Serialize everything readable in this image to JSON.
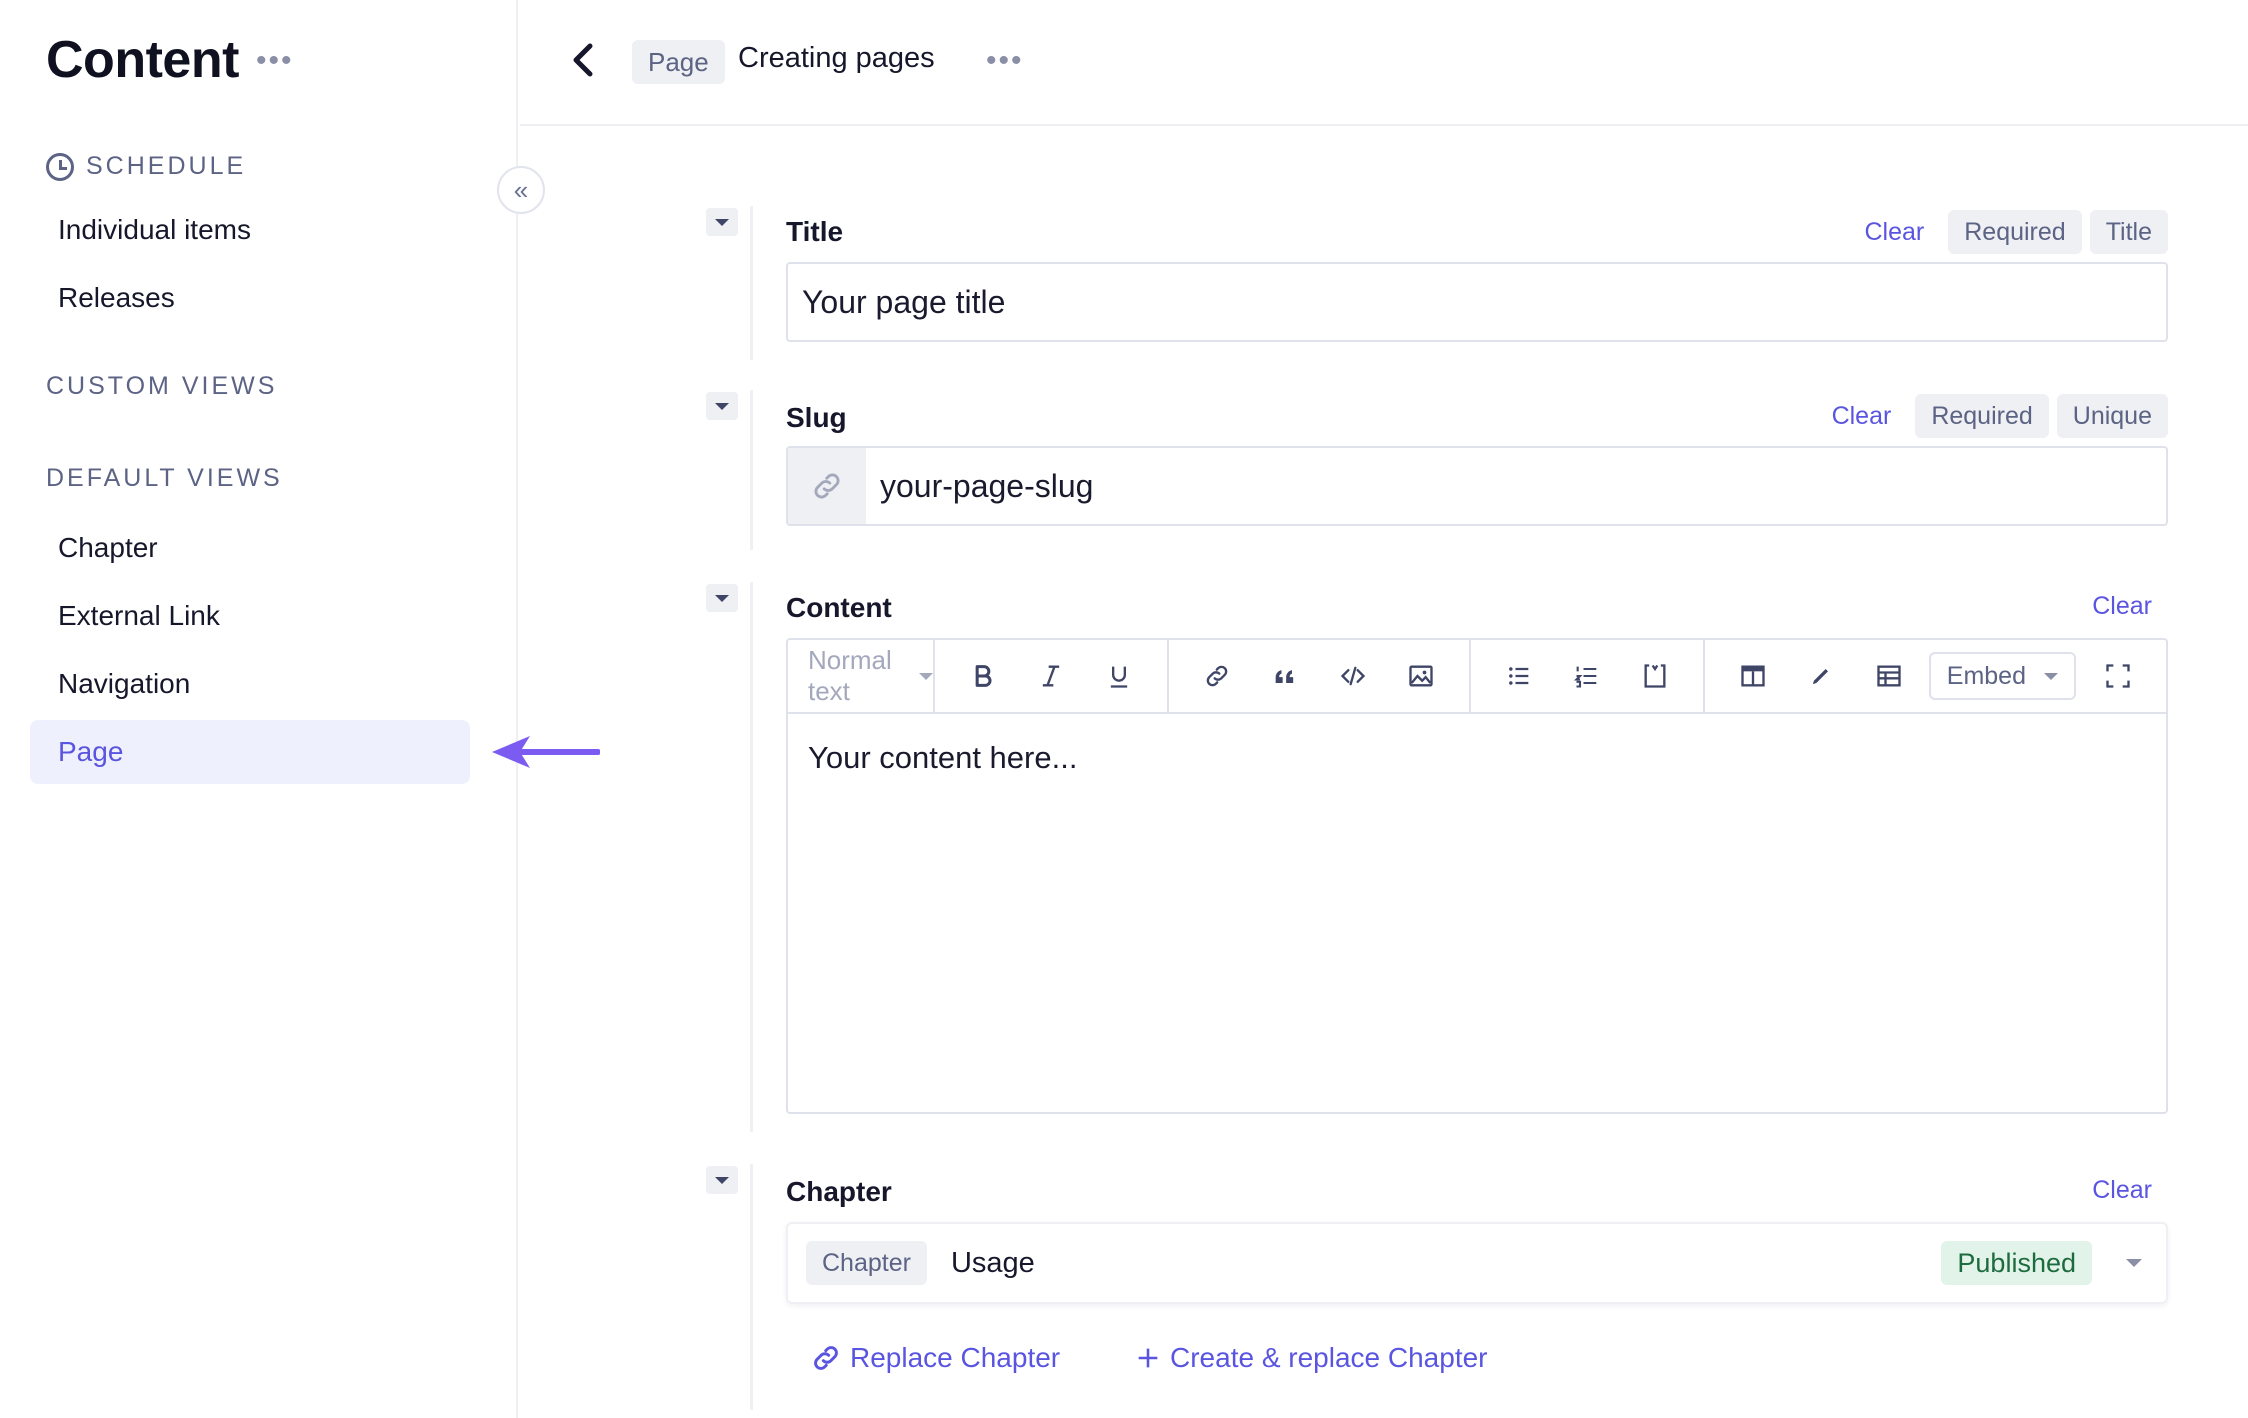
{
  "sidebar": {
    "title": "Content",
    "more": "•••",
    "collapse_icon": "«",
    "schedule_label": "SCHEDULE",
    "schedule_items": [
      {
        "label": "Individual items"
      },
      {
        "label": "Releases"
      }
    ],
    "custom_views_label": "CUSTOM VIEWS",
    "default_views_label": "DEFAULT VIEWS",
    "default_items": [
      {
        "label": "Chapter"
      },
      {
        "label": "External Link"
      },
      {
        "label": "Navigation"
      },
      {
        "label": "Page",
        "active": true
      }
    ]
  },
  "header": {
    "back_icon": "‹",
    "breadcrumb_badge": "Page",
    "title": "Creating pages",
    "more": "•••"
  },
  "fields": {
    "title": {
      "label": "Title",
      "clear": "Clear",
      "tags": [
        "Required",
        "Title"
      ],
      "value": "Your page title"
    },
    "slug": {
      "label": "Slug",
      "clear": "Clear",
      "tags": [
        "Required",
        "Unique"
      ],
      "value": "your-page-slug"
    },
    "content": {
      "label": "Content",
      "clear": "Clear",
      "format_select": "Normal text",
      "embed_label": "Embed",
      "body": "Your content here..."
    },
    "chapter": {
      "label": "Chapter",
      "clear": "Clear",
      "badge": "Chapter",
      "name": "Usage",
      "status": "Published",
      "replace_link": "Replace Chapter",
      "create_link": "Create & replace Chapter"
    }
  },
  "colors": {
    "accent": "#5a55e0",
    "arrow": "#7c5cf0",
    "published_bg": "#e2f4e9",
    "published_text": "#1e6b3f"
  }
}
